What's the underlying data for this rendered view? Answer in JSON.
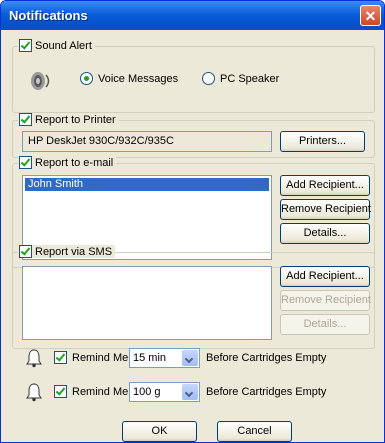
{
  "window": {
    "title": "Notifications",
    "close": "✕"
  },
  "sound": {
    "label": "Sound Alert",
    "options": [
      "Voice Messages",
      "PC Speaker"
    ],
    "selected": "Voice Messages"
  },
  "printer": {
    "label": "Report to Printer",
    "value": "HP DeskJet 930C/932C/935C",
    "button": "Printers..."
  },
  "email": {
    "label": "Report to e-mail",
    "recipients": [
      "John Smith"
    ],
    "add": "Add Recipient...",
    "remove": "Remove Recipient",
    "details": "Details..."
  },
  "sms": {
    "label": "Report via SMS",
    "add": "Add Recipient...",
    "remove": "Remove Recipient",
    "details": "Details..."
  },
  "reminders": [
    {
      "label": "Remind Me",
      "value": "15 min",
      "suffix": "Before Cartridges Empty"
    },
    {
      "label": "Remind Me",
      "value": "100 g",
      "suffix": "Before Cartridges Empty"
    }
  ],
  "footer": {
    "ok": "OK",
    "cancel": "Cancel"
  }
}
